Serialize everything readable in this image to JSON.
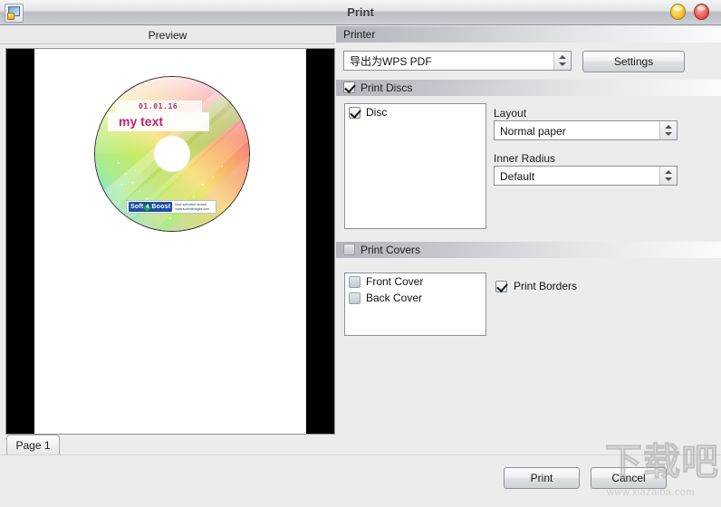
{
  "window": {
    "title": "Print",
    "icon": "print-app-icon",
    "buttons": {
      "minimize": "minimize-button",
      "close": "close-button"
    }
  },
  "preview": {
    "header_label": "Preview",
    "page_tab_label": "Page 1",
    "disc": {
      "date_text": "01.01.16",
      "title_text": "my text",
      "logo_main": "Soft",
      "logo_num": "4",
      "logo_end": "Boost",
      "logo_sub": "Now activated version\nwww.sorentimages.com"
    }
  },
  "printer_section": {
    "header": "Printer",
    "selected_printer": "导出为WPS PDF",
    "settings_button": "Settings"
  },
  "print_discs_section": {
    "header": "Print Discs",
    "header_checked": true,
    "disc_list": [
      {
        "label": "Disc",
        "checked": true
      }
    ],
    "layout_label": "Layout",
    "layout_value": "Normal paper",
    "inner_radius_label": "Inner Radius",
    "inner_radius_value": "Default"
  },
  "print_covers_section": {
    "header": "Print Covers",
    "header_checked": false,
    "cover_list": [
      {
        "label": "Front Cover",
        "checked": false
      },
      {
        "label": "Back Cover",
        "checked": false
      }
    ],
    "print_borders_label": "Print Borders",
    "print_borders_checked": true
  },
  "footer": {
    "print_button": "Print",
    "cancel_button": "Cancel"
  },
  "watermark": {
    "cn_text": "下载吧",
    "url_text": "www.xiazaiba.com"
  },
  "colors": {
    "titlebar_gradient_top": "#f4f5f6",
    "titlebar_gradient_bottom": "#cdd0d5",
    "panel_background": "#ececec",
    "section_header_left": "#b2b6bc",
    "section_header_right": "#fbfbfc",
    "close_button": "#c42e22",
    "minimize_button": "#dea00d",
    "disc_title_color": "#c2216b",
    "disc_date_color": "#b0306c",
    "logo_blue": "#1b4f9e"
  }
}
